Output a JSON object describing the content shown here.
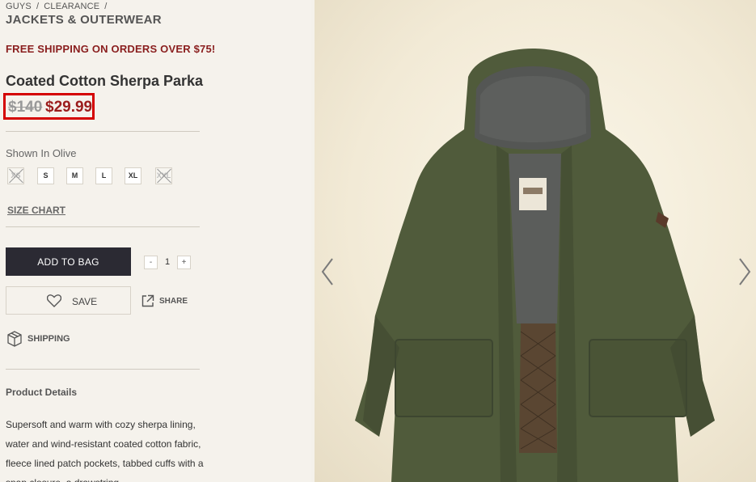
{
  "breadcrumb": {
    "items": [
      "GUYS",
      "CLEARANCE"
    ],
    "separator": "/"
  },
  "category": "JACKETS & OUTERWEAR",
  "promo": "FREE SHIPPING ON ORDERS OVER $75!",
  "product": {
    "title": "Coated Cotton Sherpa Parka",
    "old_price": "$140",
    "new_price": "$29.99",
    "shown_in": "Shown In Olive",
    "sizes": [
      {
        "label": "XS",
        "available": false
      },
      {
        "label": "S",
        "available": true
      },
      {
        "label": "M",
        "available": true
      },
      {
        "label": "L",
        "available": true
      },
      {
        "label": "XL",
        "available": true
      },
      {
        "label": "XXL",
        "available": false
      }
    ],
    "size_chart": "SIZE CHART",
    "add_to_bag": "ADD TO BAG",
    "quantity": {
      "minus": "-",
      "value": "1",
      "plus": "+"
    },
    "save": "SAVE",
    "share": "SHARE",
    "shipping": "SHIPPING",
    "details_title": "Product Details",
    "details_text": "Supersoft and warm with cozy sherpa lining, water and wind-resistant coated cotton fabric, fleece lined patch pockets, tabbed cuffs with a snap closure, a drawstring"
  },
  "gallery": {
    "prev_icon": "chevron-left-icon",
    "next_icon": "chevron-right-icon",
    "image_icon": "parka-jacket-image"
  },
  "colors": {
    "promo": "#8a1e1e",
    "price_highlight": "#d40000",
    "button_dark": "#2b2a33",
    "jacket_olive": "#4e5a3a"
  }
}
